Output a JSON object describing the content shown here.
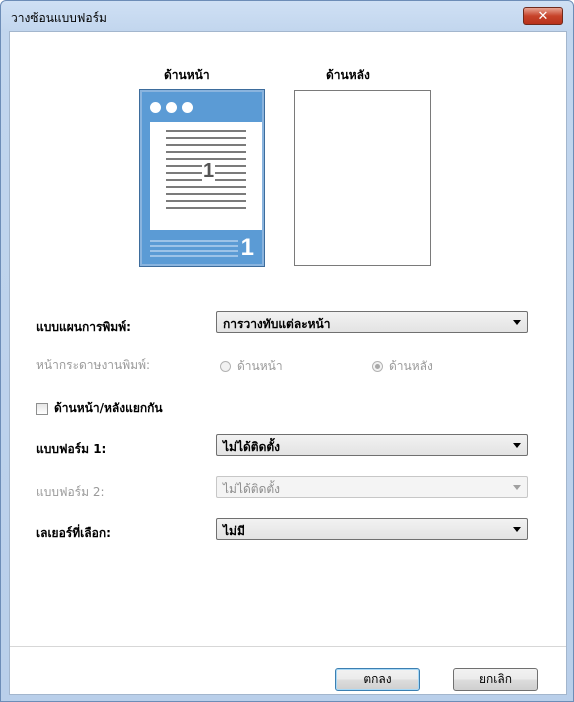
{
  "window": {
    "title": "วางซ้อนแบบฟอร์ม",
    "close_icon": "✕"
  },
  "preview": {
    "front_label": "ด้านหน้า",
    "back_label": "ด้านหลัง",
    "front_page_number": "1",
    "front_footer_number": "1"
  },
  "print_layout": {
    "label": "แบบแผนการพิมพ์:",
    "value": "การวางทับแต่ละหน้า"
  },
  "print_side": {
    "label": "หน้ากระดาษงานพิมพ์:",
    "option_front": "ด้านหน้า",
    "option_back": "ด้านหลัง",
    "selected": "ด้านหลัง"
  },
  "separate_sides": {
    "label": "ด้านหน้า/หลังแยกกัน",
    "checked": false
  },
  "form1": {
    "label": "แบบฟอร์ม 1:",
    "value": "ไม่ได้ติดตั้ง"
  },
  "form2": {
    "label": "แบบฟอร์ม 2:",
    "value": "ไม่ได้ติดตั้ง"
  },
  "layer": {
    "label": "เลเยอร์ที่เลือก:",
    "value": "ไม่มี"
  },
  "buttons": {
    "ok": "ตกลง",
    "cancel": "ยกเลิก"
  },
  "colors": {
    "accent": "#5b9bd5",
    "close": "#c7432a"
  }
}
